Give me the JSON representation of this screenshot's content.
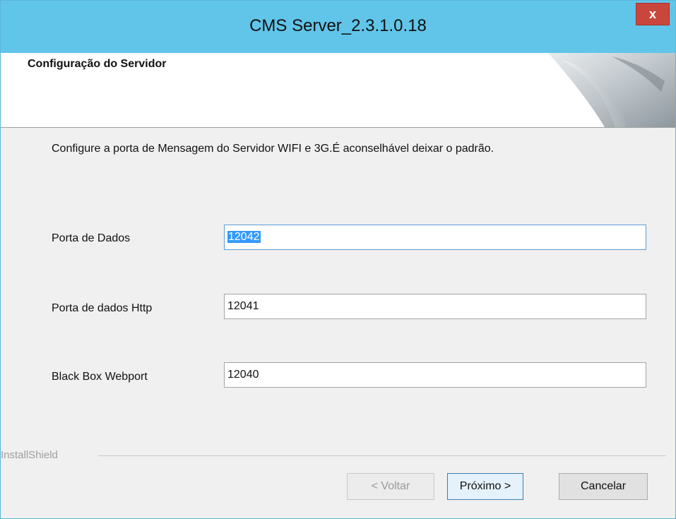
{
  "window": {
    "title": "CMS Server_2.3.1.0.18",
    "close_label": "x"
  },
  "header": {
    "title": "Configuração do Servidor"
  },
  "description": "Configure a porta de Mensagem do Servidor WIFI e 3G.É aconselhável deixar o padrão.",
  "fields": [
    {
      "label": "Porta de Dados",
      "value": "12042",
      "selected": true
    },
    {
      "label": "Porta de dados Http",
      "value": "12041",
      "selected": false
    },
    {
      "label": "Black Box Webport",
      "value": "12040",
      "selected": false
    }
  ],
  "footer": {
    "brand": "InstallShield",
    "back_label": "< Voltar",
    "next_label": "Próximo >",
    "cancel_label": "Cancelar",
    "back_enabled": false
  },
  "colors": {
    "titlebar": "#61c5e9",
    "close_button": "#c9463d",
    "selection": "#3399ff"
  }
}
